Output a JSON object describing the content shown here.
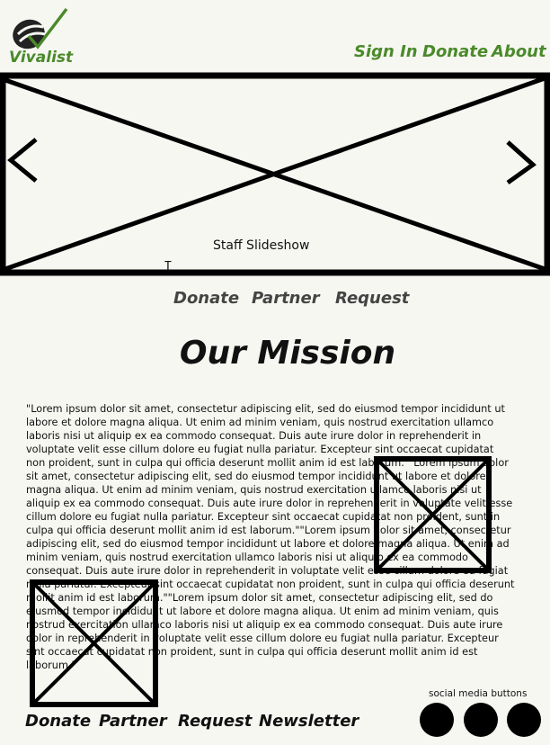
{
  "brand": {
    "name": "Vivalist",
    "color": "#4a8a2a"
  },
  "top_nav": [
    {
      "label": "Sign In"
    },
    {
      "label": "Donate"
    },
    {
      "label": "About"
    }
  ],
  "slideshow": {
    "label": "Staff Slideshow",
    "prev_icon": "chevron-left-icon",
    "next_icon": "chevron-right-icon"
  },
  "cursor_text": "T",
  "sub_nav": [
    {
      "label": "Donate"
    },
    {
      "label": "Partner"
    },
    {
      "label": "Request"
    }
  ],
  "mission": {
    "title": "Our Mission",
    "body": "\"Lorem ipsum dolor sit amet, consectetur adipiscing elit, sed do eiusmod tempor incididunt ut labore et dolore magna aliqua. Ut enim ad minim veniam, quis nostrud exercitation ullamco laboris nisi ut aliquip ex ea commodo consequat. Duis aute irure dolor in reprehenderit in voluptate velit esse cillum dolore eu fugiat nulla pariatur. Excepteur sint occaecat cupidatat non proident, sunt in culpa qui officia deserunt mollit anim id est laborum.\"\"Lorem ipsum dolor sit amet, consectetur adipiscing elit, sed do eiusmod tempor incididunt ut labore et dolore magna aliqua. Ut enim ad minim veniam, quis nostrud exercitation ullamco laboris nisi ut aliquip ex ea commodo consequat. Duis aute irure dolor in reprehenderit in voluptate velit esse cillum dolore eu fugiat nulla pariatur. Excepteur sint occaecat cupidatat non proident, sunt in culpa qui officia deserunt mollit anim id est laborum.\"\"Lorem ipsum dolor sit amet, consectetur adipiscing elit, sed do eiusmod tempor incididunt ut labore et dolore magna aliqua. Ut enim ad minim veniam, quis nostrud exercitation ullamco laboris nisi ut aliquip ex ea commodo consequat. Duis aute irure dolor in reprehenderit in voluptate velit esse cillum dolore eu fugiat nulla pariatur. Excepteur sint occaecat cupidatat non proident, sunt in culpa qui officia deserunt mollit anim id est laborum.\"\"Lorem ipsum dolor sit amet, consectetur adipiscing elit, sed do eiusmod tempor incididunt ut labore et dolore magna aliqua. Ut enim ad minim veniam, quis nostrud exercitation ullamco laboris nisi ut aliquip ex ea commodo consequat. Duis aute irure dolor in reprehenderit in voluptate velit esse cillum dolore eu fugiat nulla pariatur. Excepteur sint occaecat cupidatat non proident, sunt in culpa qui officia deserunt mollit anim id est laborum.\""
  },
  "footer_nav": [
    {
      "label": "Donate"
    },
    {
      "label": "Partner"
    },
    {
      "label": "Request"
    },
    {
      "label": "Newsletter"
    }
  ],
  "social": {
    "label": "social media buttons",
    "buttons": [
      "social-button-1",
      "social-button-2",
      "social-button-3"
    ]
  }
}
